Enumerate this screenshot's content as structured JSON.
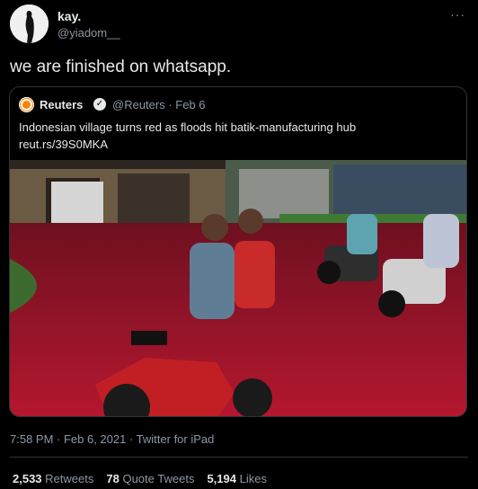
{
  "tweet": {
    "author_name": "kay.",
    "author_handle": "@yiadom__",
    "more_label": "···",
    "text": "we are finished on whatsapp.",
    "timestamp": "7:58 PM · Feb 6, 2021 · Twitter for iPad"
  },
  "quoted_tweet": {
    "author_name": "Reuters",
    "author_handle_and_time": "@Reuters · Feb 6",
    "headline": "Indonesian village turns red as floods hit batik-manufacturing hub",
    "link": "reut.rs/39S0MKA",
    "image_icon": "flood-photo"
  },
  "stats": {
    "retweets_count": "2,533",
    "retweets_label": "Retweets",
    "quotes_count": "78",
    "quotes_label": "Quote Tweets",
    "likes_count": "5,194",
    "likes_label": "Likes"
  },
  "colors": {
    "background": "#000000",
    "secondary_text": "#8b98a5",
    "border": "#2f3336",
    "flood_red": "#a3142b"
  }
}
